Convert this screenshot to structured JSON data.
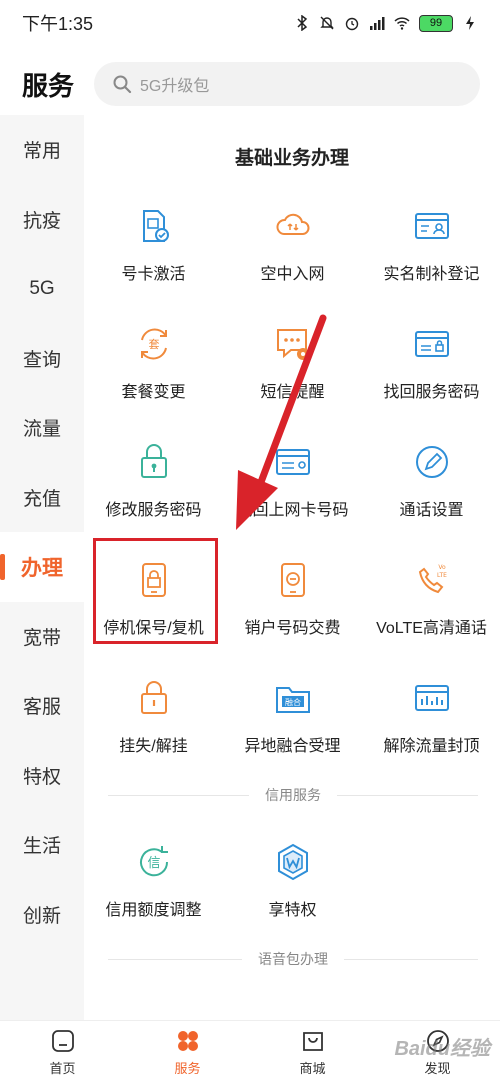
{
  "status_bar": {
    "time": "下午1:35",
    "battery": "99"
  },
  "header": {
    "title": "服务",
    "search_placeholder": "5G升级包"
  },
  "sidebar": {
    "items": [
      {
        "label": "常用"
      },
      {
        "label": "抗疫"
      },
      {
        "label": "5G"
      },
      {
        "label": "查询"
      },
      {
        "label": "流量"
      },
      {
        "label": "充值"
      },
      {
        "label": "办理"
      },
      {
        "label": "宽带"
      },
      {
        "label": "客服"
      },
      {
        "label": "特权"
      },
      {
        "label": "生活"
      },
      {
        "label": "创新"
      }
    ],
    "active_index": 6
  },
  "sections": {
    "basic": {
      "title": "基础业务办理",
      "items": [
        {
          "label": "号卡激活",
          "icon": "sim-card-check-icon"
        },
        {
          "label": "空中入网",
          "icon": "cloud-upload-icon"
        },
        {
          "label": "实名制补登记",
          "icon": "id-card-icon"
        },
        {
          "label": "套餐变更",
          "icon": "package-change-icon"
        },
        {
          "label": "短信提醒",
          "icon": "sms-settings-icon"
        },
        {
          "label": "找回服务密码",
          "icon": "password-recovery-icon"
        },
        {
          "label": "修改服务密码",
          "icon": "lock-icon"
        },
        {
          "label": "找回上网卡号码",
          "icon": "data-card-icon"
        },
        {
          "label": "通话设置",
          "icon": "pencil-icon"
        },
        {
          "label": "停机保号/复机",
          "icon": "phone-lock-icon"
        },
        {
          "label": "销户号码交费",
          "icon": "phone-minus-icon"
        },
        {
          "label": "VoLTE高清通话",
          "icon": "volte-phone-icon"
        },
        {
          "label": "挂失/解挂",
          "icon": "padlock-icon"
        },
        {
          "label": "异地融合受理",
          "icon": "folder-merge-icon"
        },
        {
          "label": "解除流量封顶",
          "icon": "data-chart-icon"
        }
      ]
    },
    "credit": {
      "title": "信用服务",
      "items": [
        {
          "label": "信用额度调整",
          "icon": "credit-circle-icon"
        },
        {
          "label": "享特权",
          "icon": "privilege-shield-icon"
        }
      ]
    },
    "voice": {
      "title": "语音包办理"
    }
  },
  "bottom_nav": {
    "items": [
      {
        "label": "首页",
        "icon": "home-icon"
      },
      {
        "label": "服务",
        "icon": "services-icon"
      },
      {
        "label": "商城",
        "icon": "shopping-bag-icon"
      },
      {
        "label": "发现",
        "icon": "compass-icon"
      }
    ],
    "active_index": 1
  },
  "colors": {
    "accent": "#f0642c",
    "highlight": "#d9232a",
    "icon_blue": "#2f8fd8",
    "icon_orange": "#f08a3c",
    "icon_green": "#3bb29a"
  },
  "watermark": "Baidu经验"
}
